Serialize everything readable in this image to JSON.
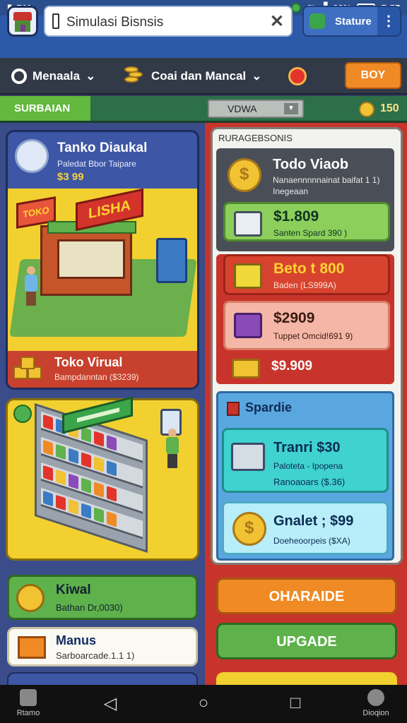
{
  "status_bar": {
    "left_text": "BM",
    "battery": "28%",
    "time": "Z:57"
  },
  "header": {
    "search_value": "Simulasi Bisnsis",
    "status_button": "Stature",
    "more_icon": "more-vertical-icon"
  },
  "toolbar": {
    "item1": "Menaala",
    "item2": "Coai dan Mancal",
    "buy_label": "BOY"
  },
  "infobar": {
    "sub_label": "SURBAIAN",
    "select_value": "VDWA",
    "coins": "150"
  },
  "store_card": {
    "title": "Tanko Diaukal",
    "subtitle": "Paledat Bbor Taipare",
    "price": "$3 99",
    "sign": "LISHA",
    "small_sign": "TOKO",
    "footer_title": "Toko Virual",
    "footer_sub": "Bampdanntan ($3239)"
  },
  "kredit_card": {
    "title": "Kiwal",
    "subtitle": "Bathan Dr,0030)"
  },
  "manus_card": {
    "title": "Manus",
    "subtitle": "Sarboarcade.1.1 1)"
  },
  "shop_panel": {
    "header": "RURAGEBSONIS",
    "top_title": "Todo Viaob",
    "top_sub1": "Nanaennnnnainat baifat 1 1)",
    "top_sub2": "Inegeaan",
    "items": [
      {
        "price": "$1.809",
        "desc": "Santen Spard 390 )"
      },
      {
        "price": "Beto t 800",
        "desc": "Baden (LS999A)"
      },
      {
        "price": "$2909",
        "desc": "Tuppet Omcid!691 9)"
      },
      {
        "price": "$9.909",
        "desc": ""
      }
    ]
  },
  "special": {
    "header": "Spardie",
    "card1_title": "Tranri $30",
    "card1_sub": "Paloteta - Ipopena",
    "card1_sub2": "Ranoaoars ($.36)",
    "card2_title": "Gnalet ; $99",
    "card2_sub": "Doeheoorpeis ($XA)"
  },
  "buttons": {
    "primary": "OHARAIDE",
    "secondary": "UPGADE"
  },
  "nav": {
    "left_tab": "Rtamo",
    "right_tab": "Dioqion"
  },
  "colors": {
    "accent_orange": "#f08a24",
    "accent_green": "#5fb14b",
    "accent_red": "#c8342b",
    "brand_blue": "#2d5aa8"
  }
}
